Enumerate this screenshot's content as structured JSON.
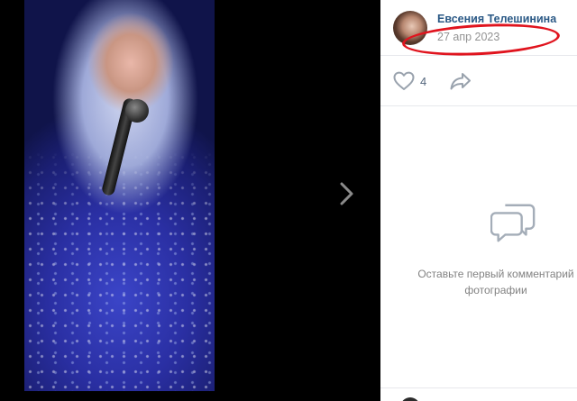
{
  "post": {
    "author_name": "Евсения Телешинина",
    "date": "27 апр 2023"
  },
  "actions": {
    "like_count": "4"
  },
  "comments": {
    "empty_line1": "Оставьте первый комментарий",
    "empty_line2": "фотографии"
  },
  "icons": {
    "like": "heart-icon",
    "share": "share-icon",
    "next": "chevron-right-icon",
    "comments": "speech-bubbles-icon"
  },
  "colors": {
    "author_link": "#2a5885",
    "muted_text": "#939393",
    "annotation": "#e0141e",
    "icon": "#99a2ad"
  }
}
